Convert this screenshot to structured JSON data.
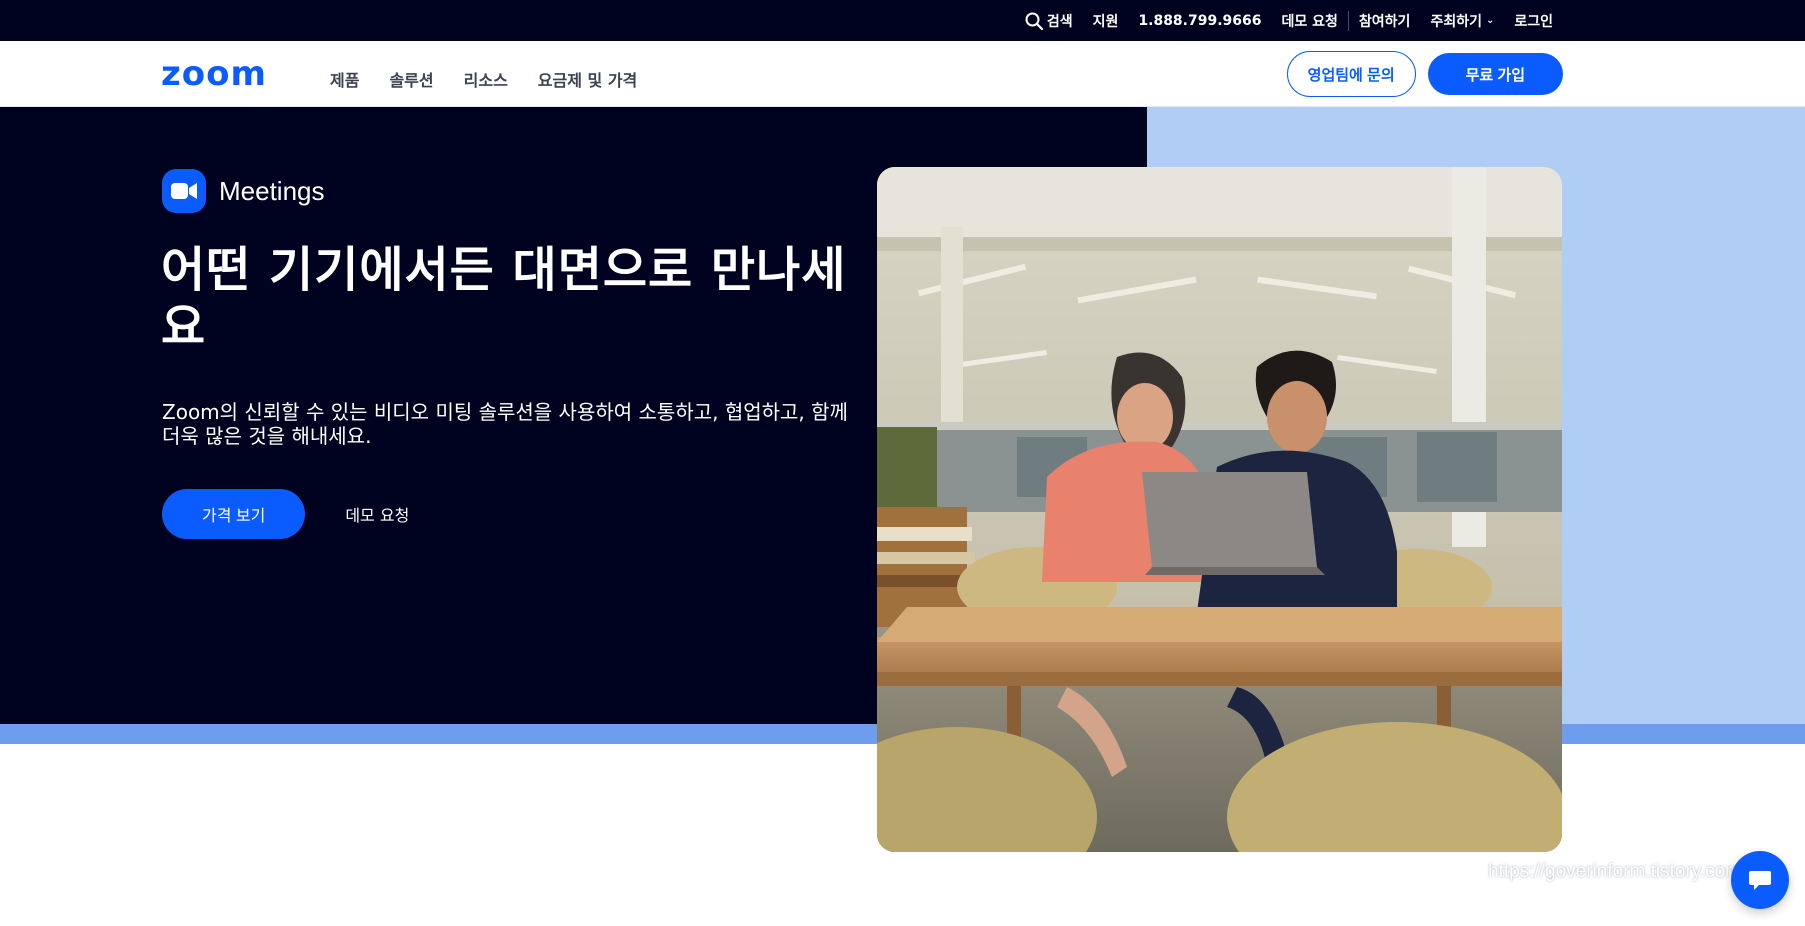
{
  "topbar": {
    "search": "검색",
    "support": "지원",
    "phone": "1.888.799.9666",
    "demo": "데모 요청",
    "join": "참여하기",
    "host": "주최하기",
    "login": "로그인"
  },
  "nav": {
    "logo": "zoom",
    "links": [
      "제품",
      "솔루션",
      "리소스",
      "요금제 및 가격"
    ],
    "contact_sales": "영업팀에 문의",
    "signup": "무료 가입"
  },
  "hero": {
    "product": "Meetings",
    "title": "어떤 기기에서든 대면으로 만나세요",
    "description": "Zoom의 신뢰할 수 있는 비디오 미팅 솔루션을 사용하여 소통하고, 협업하고, 함께 더욱 많은 것을 해내세요.",
    "primary_cta": "가격 보기",
    "secondary_cta": "데모 요청"
  },
  "watermark": "https://goverinform.tistory.com",
  "colors": {
    "brand_blue": "#0b5cff",
    "navy": "#00031f",
    "light_blue": "#b0cdf6",
    "band_blue": "#6d9dec"
  },
  "icons": [
    "search-icon",
    "chevron-down-icon",
    "video-camera-icon",
    "chat-bubble-icon"
  ]
}
